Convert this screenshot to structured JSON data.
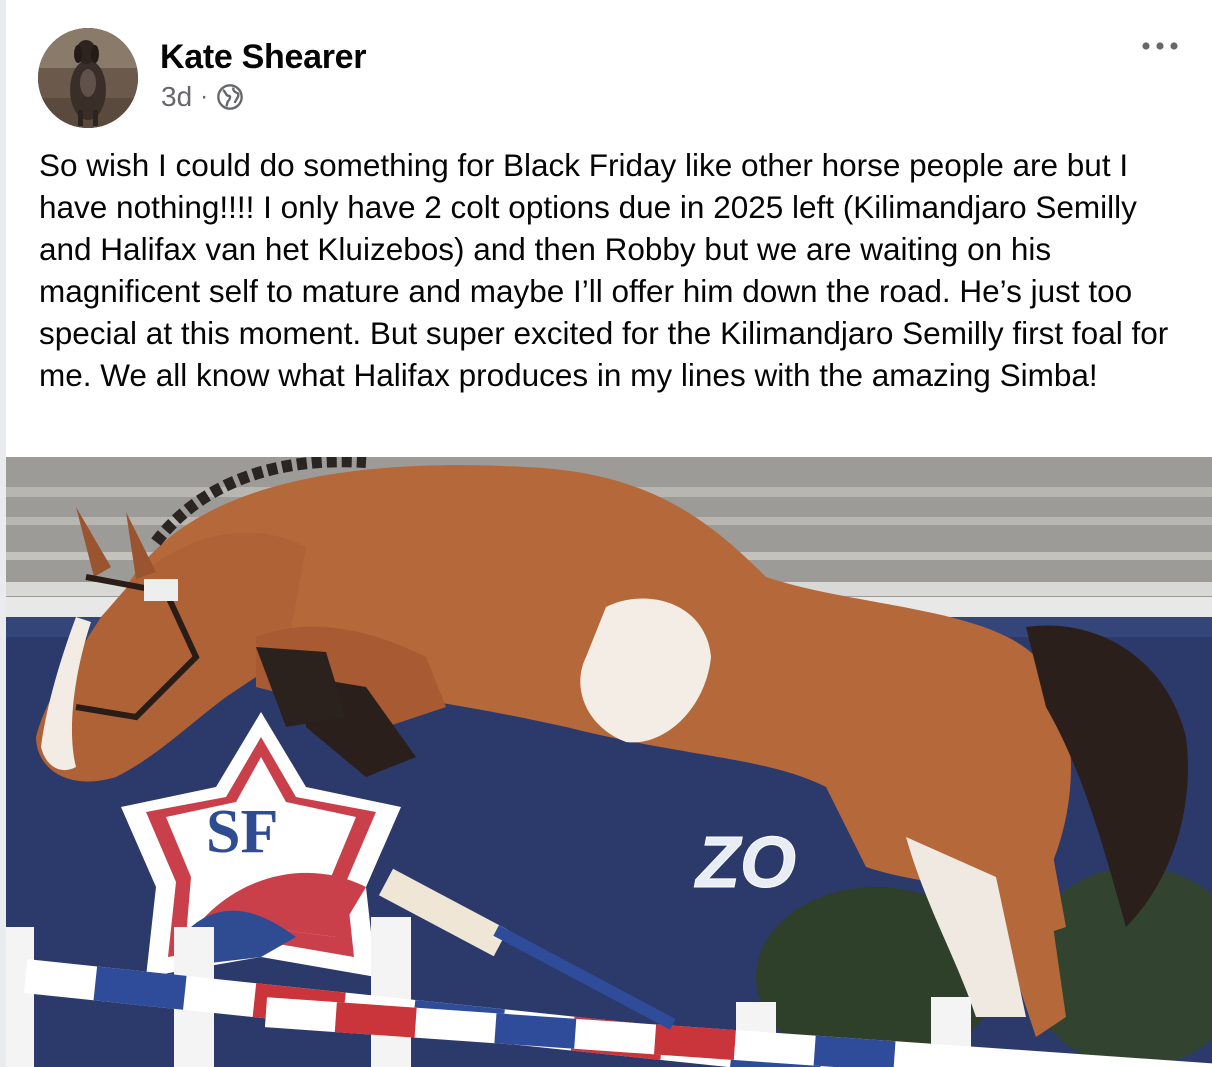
{
  "post": {
    "author": "Kate Shearer",
    "time": "3d",
    "separator": "·",
    "privacy_icon": "globe-icon",
    "more_icon": "more-horizontal-icon",
    "text": "So wish I could do something for Black Friday like other horse people are but I have nothing!!!! I only have 2 colt options due in 2025 left (Kilimandjaro Semilly and Halifax van het Kluizebos) and then Robby but we are waiting on his magnificent self to mature and maybe I’ll offer him down the road. He’s just too special at this moment. But super excited for the Kilimandjaro Semilly first foal for me. We all know what Halifax produces in my lines with the amazing Simba!"
  },
  "photo": {
    "logo_text": "SF",
    "banner_text": "ZO"
  },
  "colors": {
    "text": "#050505",
    "secondary_text": "#65676b",
    "banner_navy": "#2b3a6b",
    "horse_chestnut": "#b5683a"
  }
}
